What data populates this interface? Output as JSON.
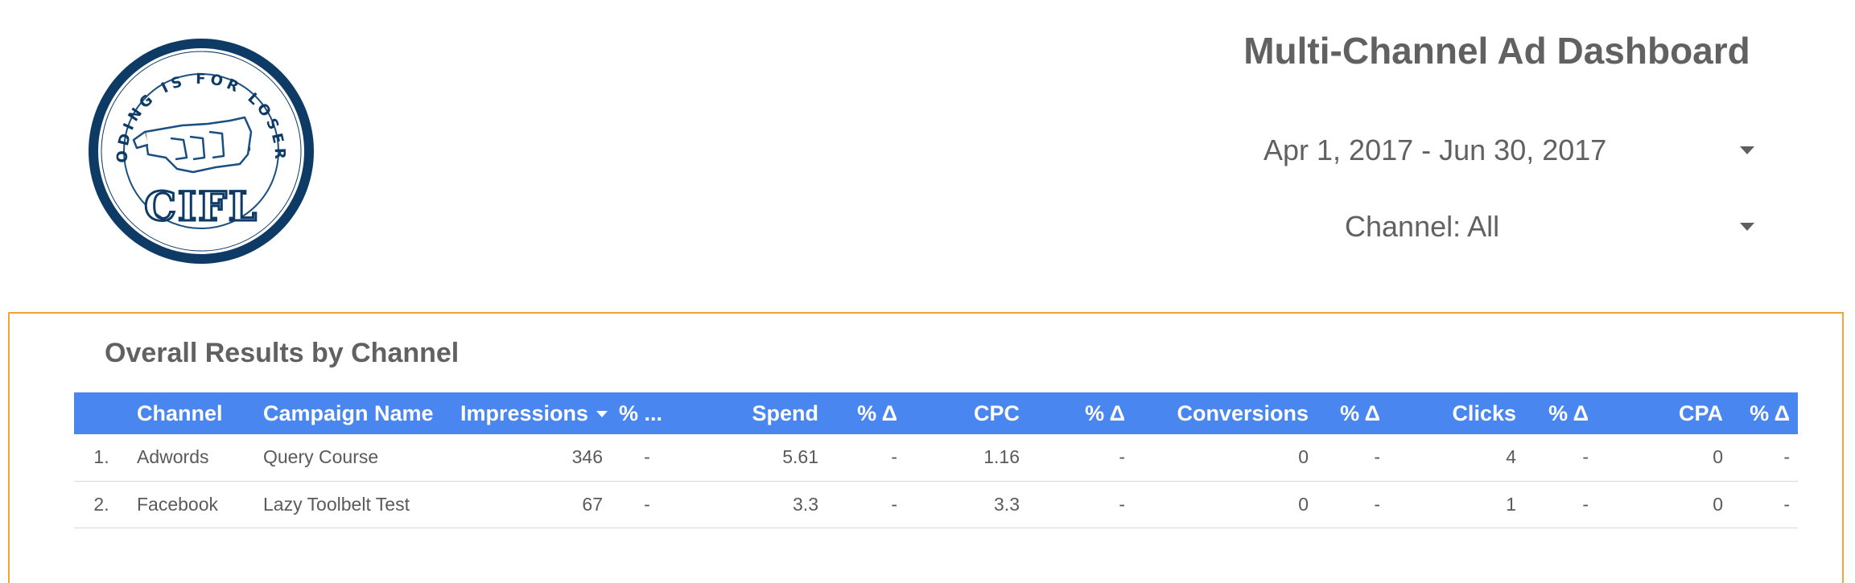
{
  "logo": {
    "top_text": "CODING IS FOR LOSERS",
    "bottom_text": "CIFL",
    "colors": {
      "ring": "#0d3b66",
      "ink": "#1a4f82"
    }
  },
  "header": {
    "title": "Multi-Channel Ad Dashboard",
    "date_range": {
      "label": "Apr 1, 2017 - Jun 30, 2017",
      "icon": "chevron-down-icon"
    },
    "channel_filter": {
      "label": "Channel: All",
      "icon": "chevron-down-icon"
    }
  },
  "panel": {
    "title": "Overall Results by Channel",
    "border_color": "#f0a43a",
    "header_color": "#4a86f0",
    "columns": [
      {
        "label": ""
      },
      {
        "label": "Channel"
      },
      {
        "label": "Campaign Name"
      },
      {
        "label": "Impressions",
        "sorted": "descending"
      },
      {
        "label": "% ..."
      },
      {
        "label": "Spend"
      },
      {
        "label": "% Δ"
      },
      {
        "label": "CPC"
      },
      {
        "label": "% Δ"
      },
      {
        "label": "Conversions"
      },
      {
        "label": "% Δ"
      },
      {
        "label": "Clicks"
      },
      {
        "label": "% Δ"
      },
      {
        "label": "CPA"
      },
      {
        "label": "% Δ"
      }
    ],
    "rows": [
      {
        "index": "1.",
        "channel": "Adwords",
        "campaign": "Query Course",
        "impressions": "346",
        "impressions_delta": "-",
        "spend": "5.61",
        "spend_delta": "-",
        "cpc": "1.16",
        "cpc_delta": "-",
        "conversions": "0",
        "conversions_delta": "-",
        "clicks": "4",
        "clicks_delta": "-",
        "cpa": "0",
        "cpa_delta": "-"
      },
      {
        "index": "2.",
        "channel": "Facebook",
        "campaign": "Lazy Toolbelt Test",
        "impressions": "67",
        "impressions_delta": "-",
        "spend": "3.3",
        "spend_delta": "-",
        "cpc": "3.3",
        "cpc_delta": "-",
        "conversions": "0",
        "conversions_delta": "-",
        "clicks": "1",
        "clicks_delta": "-",
        "cpa": "0",
        "cpa_delta": "-"
      }
    ]
  }
}
